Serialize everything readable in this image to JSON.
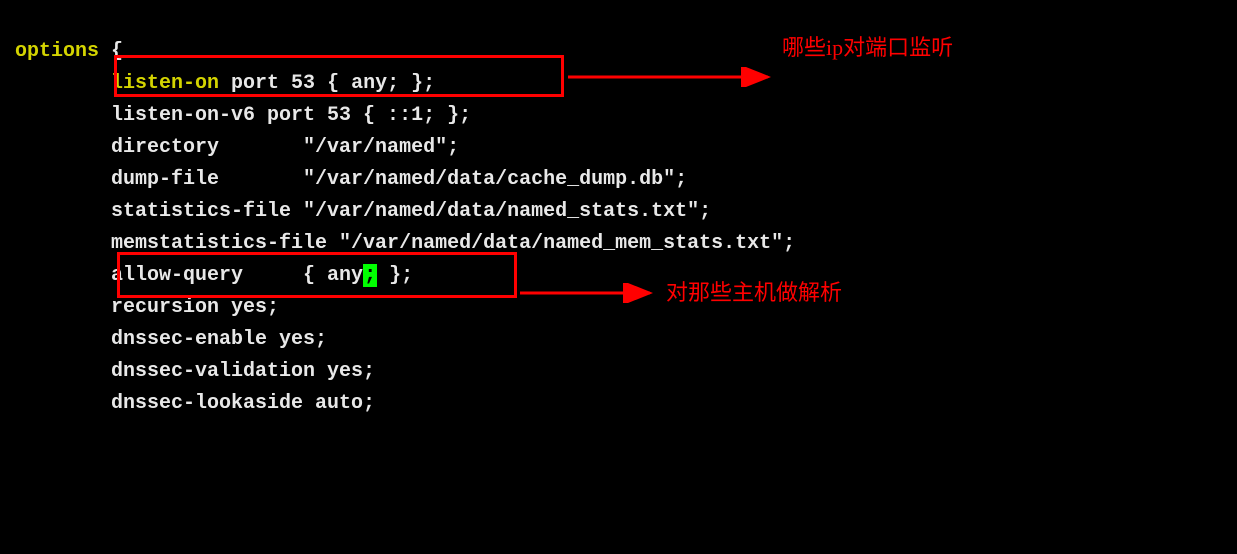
{
  "code": {
    "keyword_options": "options",
    "brace_open": " {",
    "line1_prefix": "        ",
    "line1_key": "listen-on",
    "line1_rest": " port 53 { any; };",
    "line2": "        listen-on-v6 port 53 { ::1; };",
    "line3": "        directory       \"/var/named\";",
    "line4": "        dump-file       \"/var/named/data/cache_dump.db\";",
    "line5": "        statistics-file \"/var/named/data/named_stats.txt\";",
    "line6": "        memstatistics-file \"/var/named/data/named_mem_stats.txt\";",
    "line7_prefix": "        allow-query     { any",
    "line7_cursor": ";",
    "line7_rest": " };",
    "line8": "        recursion yes;",
    "line9": "",
    "line10": "        dnssec-enable yes;",
    "line11": "        dnssec-validation yes;",
    "line12": "        dnssec-lookaside auto;"
  },
  "annotations": {
    "a1": "哪些ip对端口监听",
    "a2": "对那些主机做解析"
  }
}
